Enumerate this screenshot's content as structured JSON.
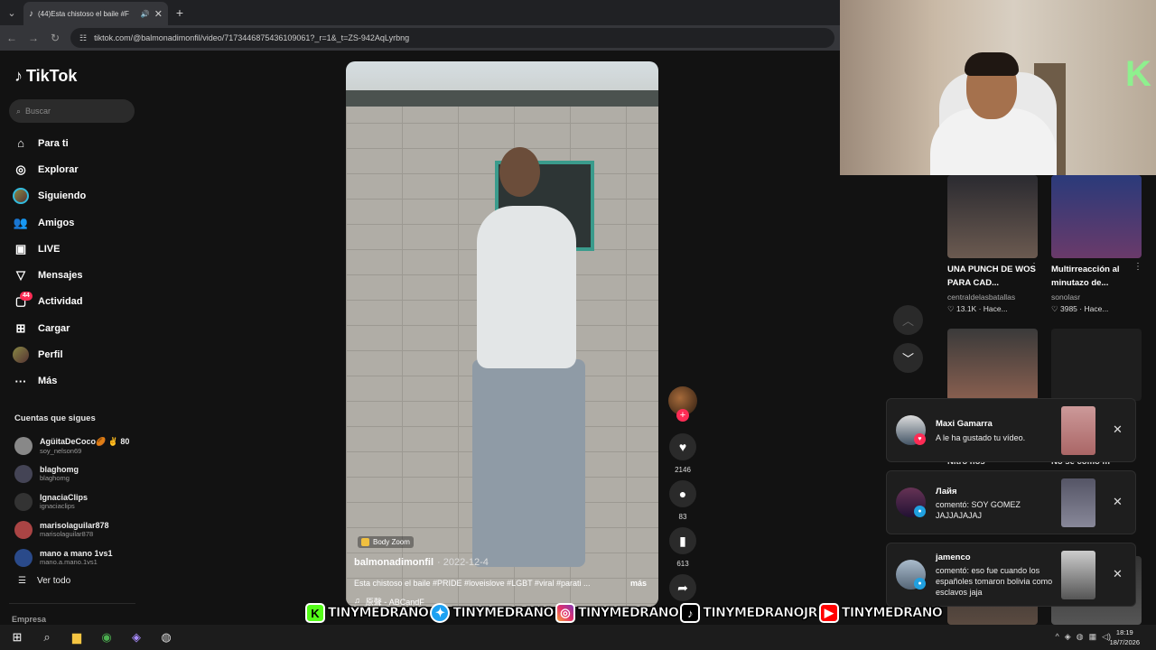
{
  "browser": {
    "tab_title": "(44)Esta chistoso el baile #F",
    "url": "tiktok.com/@balmonadimonfil/video/7173446875436109061?_r=1&_t=ZS-942AqLyrbng"
  },
  "sidebar": {
    "logo": "TikTok",
    "search_placeholder": "Buscar",
    "nav": [
      {
        "label": "Para ti",
        "icon": "home-icon"
      },
      {
        "label": "Explorar",
        "icon": "compass-icon"
      },
      {
        "label": "Siguiendo",
        "icon": "following-avatar"
      },
      {
        "label": "Amigos",
        "icon": "friends-icon"
      },
      {
        "label": "LIVE",
        "icon": "live-icon"
      },
      {
        "label": "Mensajes",
        "icon": "messages-icon"
      },
      {
        "label": "Actividad",
        "icon": "activity-icon",
        "badge": "44"
      },
      {
        "label": "Cargar",
        "icon": "upload-icon"
      },
      {
        "label": "Perfil",
        "icon": "profile-avatar"
      },
      {
        "label": "Más",
        "icon": "more-icon"
      }
    ],
    "following_title": "Cuentas que sigues",
    "accounts": [
      {
        "name": "AgüitaDeCoco🏉 ✌️ 80",
        "handle": "soy_nelson69"
      },
      {
        "name": "blaghomg",
        "handle": "blaghomg"
      },
      {
        "name": "IgnaciaClips",
        "handle": "ignaciaclips"
      },
      {
        "name": "marisolaguilar878",
        "handle": "marisolaguilar878"
      },
      {
        "name": "mano a mano 1vs1",
        "handle": "mano.a.mano.1vs1"
      }
    ],
    "see_all": "Ver todo",
    "empresa": "Empresa"
  },
  "video": {
    "effect_tag": "Body Zoom",
    "author": "balmonadimonfil",
    "date": "· 2022-12-4",
    "description": "Esta chistoso el baile #PRIDE #loveislove #LGBT #viral #parati ...",
    "more": "más",
    "music": "原聲 - ABCandF"
  },
  "actions": {
    "likes": "2146",
    "comments": "83",
    "saves": "613"
  },
  "recommendations": [
    {
      "title": "UNA PUNCH DE WOS PARA CAD...",
      "author": "centraldelasbatallas",
      "likes": "13.1K",
      "time": "Hace..."
    },
    {
      "title": "Multirreacción al minutazo de...",
      "author": "sonolasr",
      "likes": "3985",
      "time": "Hace..."
    }
  ],
  "hidden_titles": [
    "Nitro nos",
    "No se como m"
  ],
  "notifications": [
    {
      "who": "Maxi Gamarra",
      "msg": "A le ha gustado tu vídeo."
    },
    {
      "who": "Лайя",
      "msg": "comentó: SOY GOMEZ JAJJAJAJAJ"
    },
    {
      "who": "jamenco",
      "msg": "comentó: eso fue cuando los españoles tomaron bolivia como esclavos jaja"
    }
  ],
  "banner": [
    {
      "platform": "kick",
      "handle": "TINYMEDRANO"
    },
    {
      "platform": "twitter",
      "handle": "TINYMEDRANO"
    },
    {
      "platform": "instagram",
      "handle": "TINYMEDRANO"
    },
    {
      "platform": "tiktok",
      "handle": "TINYMEDRANOJR"
    },
    {
      "platform": "youtube",
      "handle": "TINYMEDRANO"
    }
  ],
  "taskbar": {
    "time": "18:19",
    "date": "18/7/2026"
  },
  "colors": {
    "accent": "#fe2c55",
    "bg": "#121212"
  }
}
